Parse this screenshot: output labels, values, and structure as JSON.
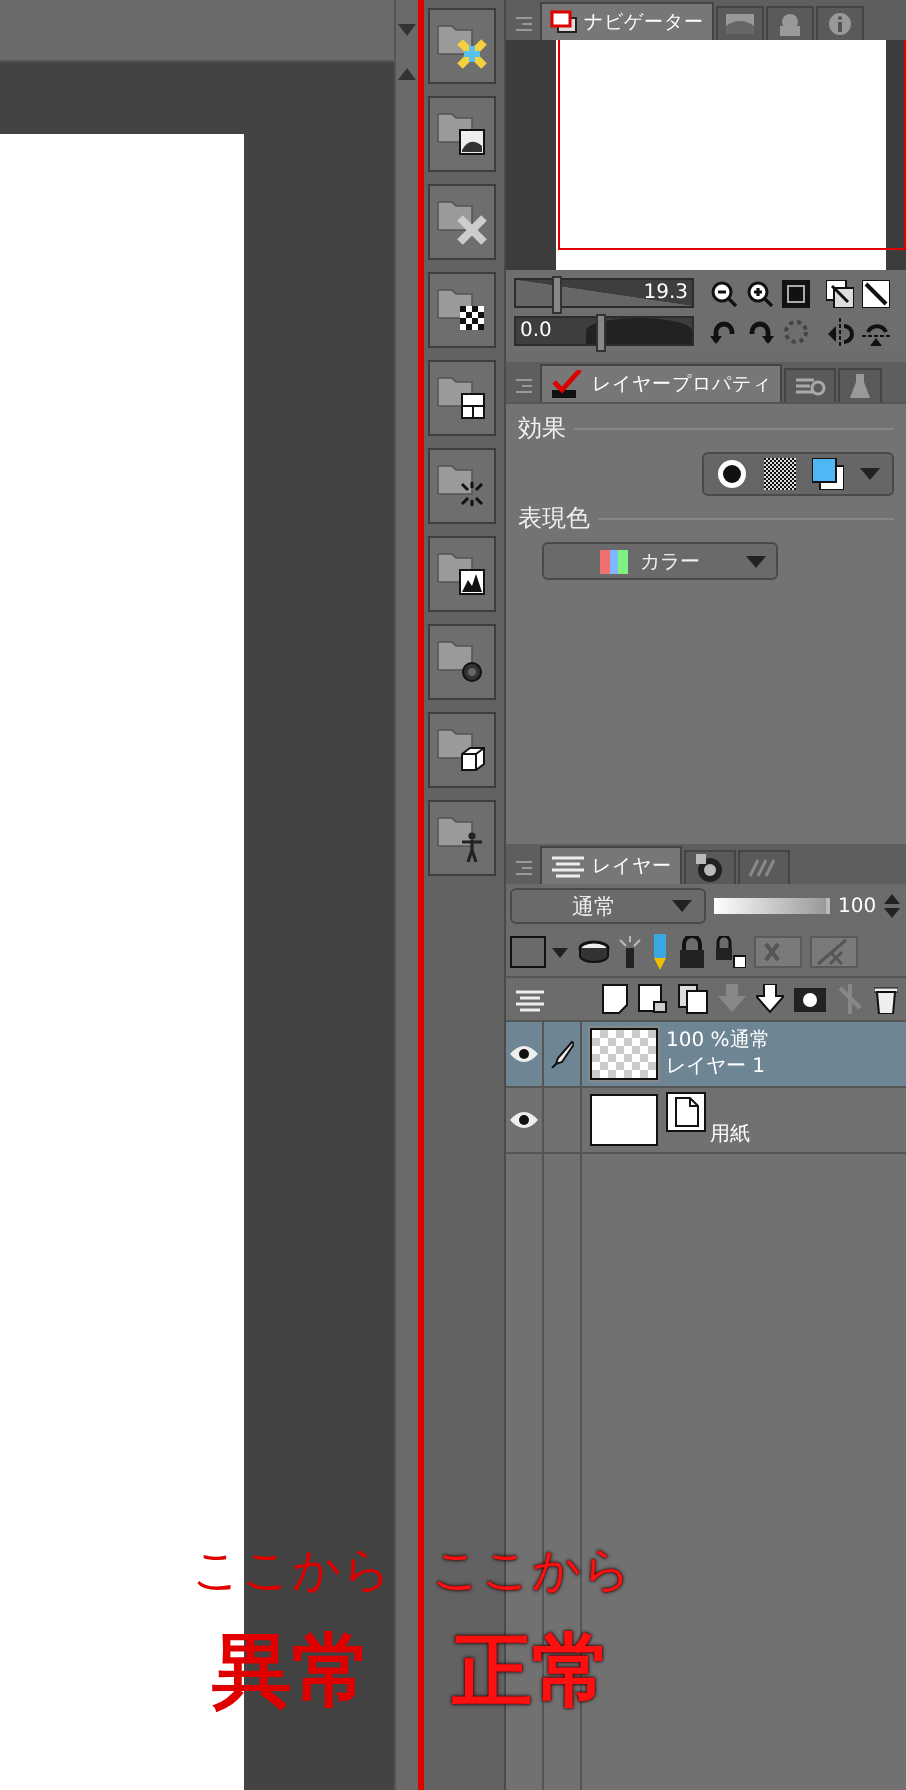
{
  "navigator": {
    "tabs": [
      {
        "kind": "navigator",
        "label": "ナビゲーター",
        "selected": true
      },
      {
        "kind": "image",
        "selected": false
      },
      {
        "kind": "stamp",
        "selected": false
      },
      {
        "kind": "info",
        "selected": false
      }
    ],
    "zoom": {
      "reading": "19.3",
      "level": 0.2
    },
    "rotation": {
      "reading": "0.0",
      "level": 0.45
    }
  },
  "layer_property": {
    "tabs": [
      {
        "kind": "property",
        "label": "レイヤープロパティ",
        "selected": true
      },
      {
        "kind": "search",
        "selected": false
      },
      {
        "kind": "flask",
        "selected": false
      }
    ],
    "effect_label": "効果",
    "color_label": "表現色",
    "color_mode": "カラー"
  },
  "layers_panel": {
    "tabs": [
      {
        "kind": "layers",
        "label": "レイヤー",
        "selected": true
      },
      {
        "kind": "animation",
        "selected": false
      },
      {
        "kind": "history",
        "selected": false
      }
    ],
    "blend_mode": "通常",
    "opacity": {
      "reading": "100",
      "level": 1
    },
    "layers": [
      {
        "kind": "raster",
        "info": "100 %通常",
        "name": "レイヤー 1",
        "visible": true,
        "selected": true
      },
      {
        "kind": "paper",
        "name": "用紙",
        "visible": true,
        "selected": false
      }
    ]
  },
  "annotations": [
    {
      "caption": "ここから",
      "label": "異常"
    },
    {
      "caption": "ここから",
      "label": "正常"
    }
  ]
}
